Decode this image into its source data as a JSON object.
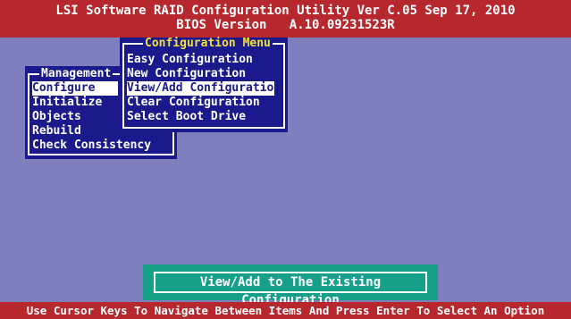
{
  "header": {
    "line1": "LSI Software RAID Configuration Utility Ver C.05 Sep 17, 2010",
    "line2": "BIOS Version   A.10.09231523R"
  },
  "management_menu": {
    "title": "Management",
    "items": [
      "Configure",
      "Initialize",
      "Objects",
      "Rebuild",
      "Check Consistency"
    ],
    "selected": "Configure"
  },
  "configuration_menu": {
    "title": "Configuration Menu",
    "items": [
      "Easy Configuration",
      "New Configuration",
      "View/Add Configuration",
      "Clear Configuration",
      "Select Boot Drive"
    ],
    "selected": "View/Add Configuration"
  },
  "status": {
    "text": "View/Add to The Existing Configuration"
  },
  "footer": {
    "text": "Use Cursor Keys To Navigate Between Items And Press Enter To Select An Option"
  },
  "colors": {
    "background": "#7f7fc0",
    "bar": "#b7282e",
    "menu": "#1a1a8c",
    "status": "#16a08a",
    "menu_title_highlight": "#f0e040"
  }
}
